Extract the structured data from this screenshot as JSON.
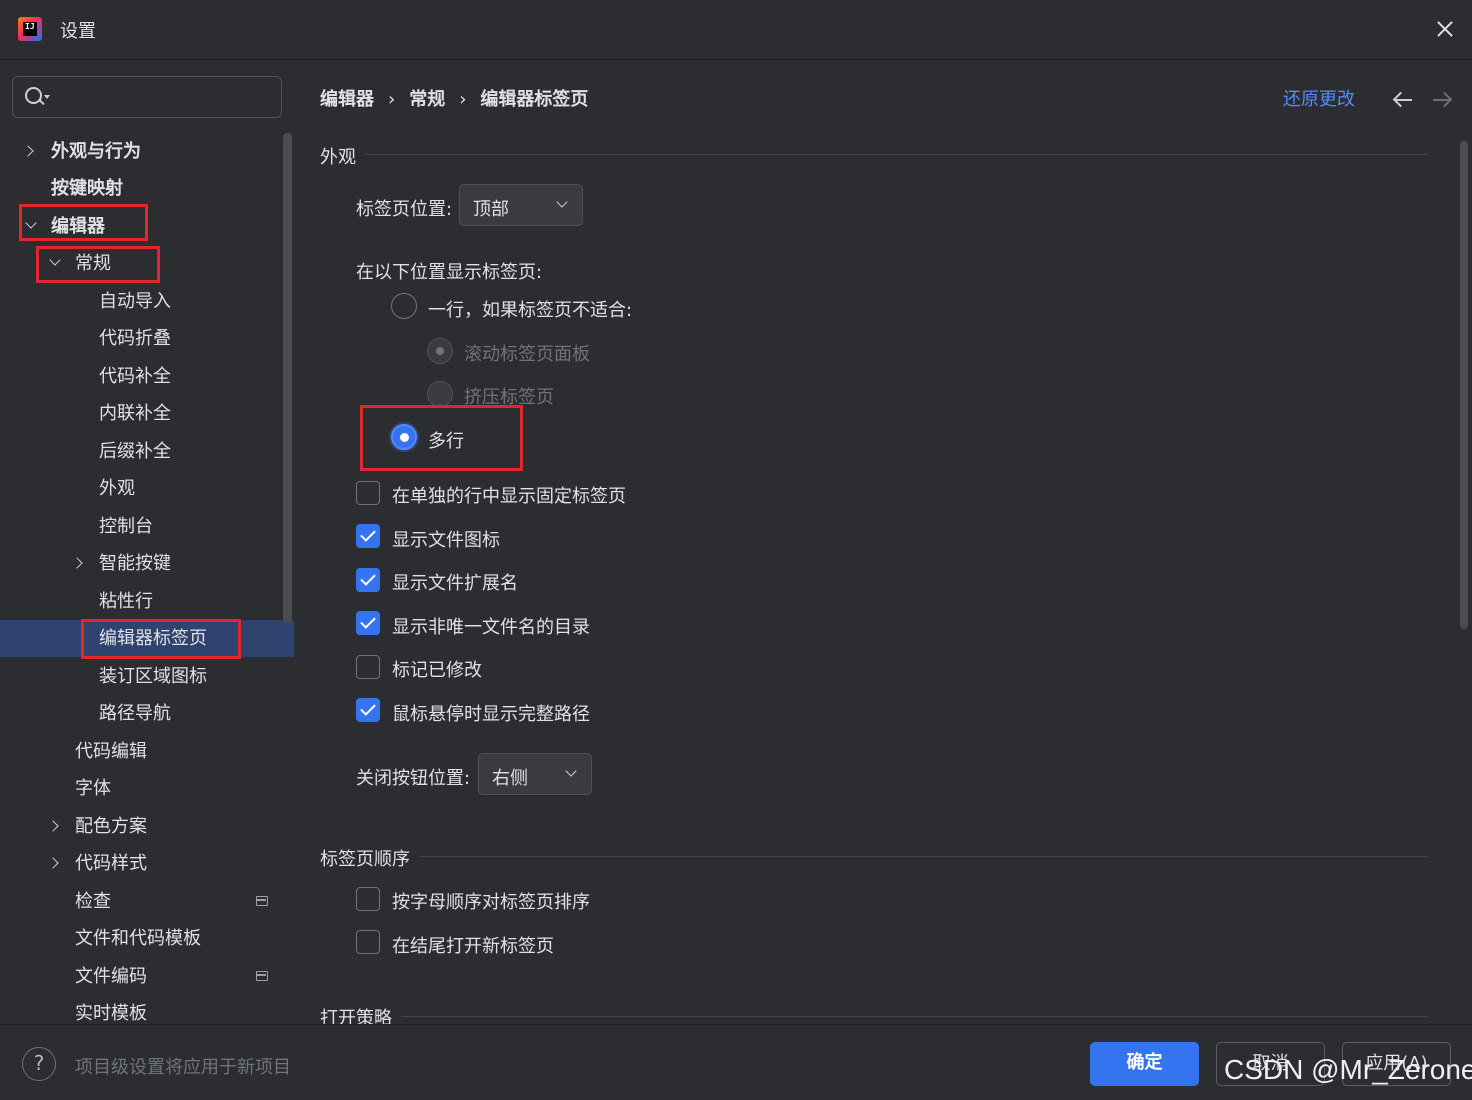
{
  "window": {
    "title": "设置",
    "logo_text": "IJ"
  },
  "search": {
    "placeholder": ""
  },
  "sidebar": {
    "items": [
      {
        "label": "外观与行为"
      },
      {
        "label": "按键映射"
      },
      {
        "label": "编辑器"
      },
      {
        "label": "常规"
      },
      {
        "label": "自动导入"
      },
      {
        "label": "代码折叠"
      },
      {
        "label": "代码补全"
      },
      {
        "label": "内联补全"
      },
      {
        "label": "后缀补全"
      },
      {
        "label": "外观"
      },
      {
        "label": "控制台"
      },
      {
        "label": "智能按键"
      },
      {
        "label": "粘性行"
      },
      {
        "label": "编辑器标签页"
      },
      {
        "label": "装订区域图标"
      },
      {
        "label": "路径导航"
      },
      {
        "label": "代码编辑"
      },
      {
        "label": "字体"
      },
      {
        "label": "配色方案"
      },
      {
        "label": "代码样式"
      },
      {
        "label": "检查"
      },
      {
        "label": "文件和代码模板"
      },
      {
        "label": "文件编码"
      },
      {
        "label": "实时模板"
      }
    ]
  },
  "breadcrumb": {
    "items": [
      "编辑器",
      "常规",
      "编辑器标签页"
    ],
    "separator": "›"
  },
  "header": {
    "reset_label": "还原更改"
  },
  "appearance": {
    "title": "外观",
    "tab_position_label": "标签页位置:",
    "tab_position_value": "顶部",
    "show_tabs_label": "在以下位置显示标签页:",
    "option_single_row": "一行，如果标签页不适合:",
    "option_scroll": "滚动标签页面板",
    "option_squeeze": "挤压标签页",
    "option_multi_row": "多行",
    "pinned_separate_row": "在单独的行中显示固定标签页",
    "show_file_icon": "显示文件图标",
    "show_file_extension": "显示文件扩展名",
    "show_dir_non_unique": "显示非唯一文件名的目录",
    "mark_modified": "标记已修改",
    "show_full_path_hover": "鼠标悬停时显示完整路径",
    "close_button_label": "关闭按钮位置:",
    "close_button_value": "右侧"
  },
  "tab_order": {
    "title": "标签页顺序",
    "sort_alphabetically": "按字母顺序对标签页排序",
    "open_at_end": "在结尾打开新标签页"
  },
  "open_policy": {
    "title": "打开策略"
  },
  "footer": {
    "help": "?",
    "note": "项目级设置将应用于新项目",
    "ok": "确定",
    "cancel": "取消",
    "apply": "应用(A)"
  },
  "watermark": "CSDN @Mr_Zerone",
  "colors": {
    "accent": "#3574f0",
    "link": "#548af7",
    "highlight_box": "#e3262e",
    "selection": "#2e436e",
    "background": "#2b2d30"
  }
}
